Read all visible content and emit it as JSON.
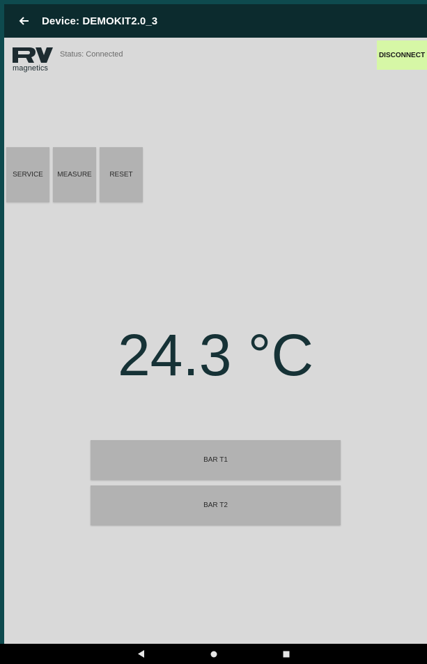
{
  "appbar": {
    "title": "Device: DEMOKIT2.0_3"
  },
  "logo": {
    "sub": "magnetics"
  },
  "status": {
    "text": "Status: Connected"
  },
  "buttons": {
    "disconnect": "DISCONNECT",
    "service": "SERVICE",
    "measure": "MEASURE",
    "reset": "RESET",
    "bar_t1": "BAR T1",
    "bar_t2": "BAR T2"
  },
  "temperature": {
    "display": "24.3 °C"
  },
  "icons": {
    "back": "arrow-left-icon",
    "logo": "rv-logo",
    "nav_back": "triangle-left-icon",
    "nav_home": "circle-icon",
    "nav_recents": "square-icon"
  },
  "colors": {
    "appbar": "#0c2b2e",
    "disconnect": "#d6f7a6",
    "button": "#b2b2b2"
  }
}
